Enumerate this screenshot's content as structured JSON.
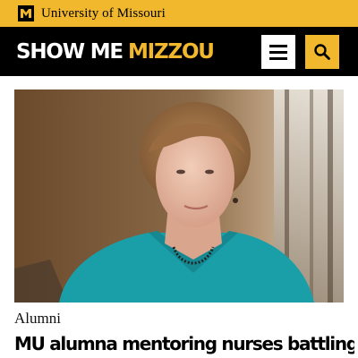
{
  "topbar": {
    "university_name": "University of Missouri",
    "logo_icon": "mu-shield-logo-icon"
  },
  "header": {
    "brand_part1": "SHOW ME",
    "brand_part2": "MIZZOU",
    "menu_icon": "hamburger-menu-icon",
    "search_icon": "search-icon"
  },
  "article": {
    "image_subject": "portrait-photo",
    "category": "Alumni",
    "headline": "MU alumna mentoring nurses battling"
  },
  "colors": {
    "gold": "#f1b82d",
    "black": "#000000",
    "shirt_teal": "#1a9ea8"
  }
}
